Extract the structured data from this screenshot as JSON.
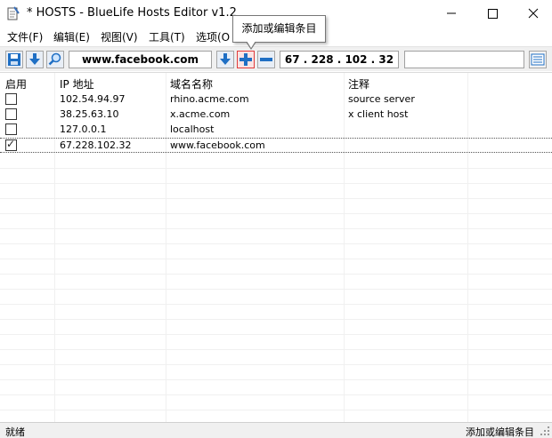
{
  "window": {
    "title": "* HOSTS - BlueLife Hosts Editor v1.2",
    "icons": [
      "notepad-icon",
      "minimize-icon",
      "maximize-icon",
      "close-icon"
    ]
  },
  "menu": {
    "items": [
      "文件(F)",
      "编辑(E)",
      "视图(V)",
      "工具(T)",
      "选项(O"
    ]
  },
  "toolbar": {
    "domain_value": "www.facebook.com",
    "ip_value": "67  . 228 . 102 .  32",
    "comment_value": "",
    "icons": [
      "save-icon",
      "download-icon",
      "search-icon",
      "arrow-down-icon",
      "add-icon",
      "remove-icon",
      "list-view-icon"
    ]
  },
  "tooltip": {
    "text": "添加或编辑条目"
  },
  "list": {
    "columns": [
      "启用",
      "IP 地址",
      "域名名称",
      "注释"
    ],
    "rows": [
      {
        "enabled": false,
        "ip": "102.54.94.97",
        "domain": "rhino.acme.com",
        "comment": "source server"
      },
      {
        "enabled": false,
        "ip": "38.25.63.10",
        "domain": "x.acme.com",
        "comment": "x client host"
      },
      {
        "enabled": false,
        "ip": "127.0.0.1",
        "domain": "localhost",
        "comment": ""
      },
      {
        "enabled": true,
        "ip": "67.228.102.32",
        "domain": "www.facebook.com",
        "comment": ""
      }
    ]
  },
  "status": {
    "left": "就绪",
    "right": "添加或编辑条目"
  },
  "colors": {
    "accent_blue": "#1f6fc4",
    "add_highlight": "#e03c3c",
    "toolbar_bg": "#f0f0f0"
  }
}
